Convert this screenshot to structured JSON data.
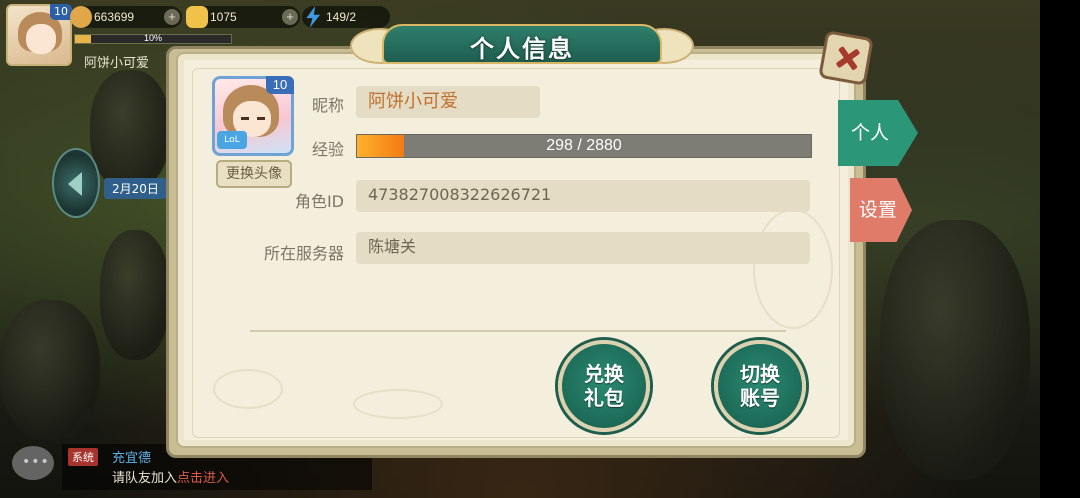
{
  "hud": {
    "level": "10",
    "exp_percent_text": "10%",
    "exp_fraction": 0.1,
    "player_name": "阿饼小可爱",
    "resources": [
      {
        "name": "coins",
        "value": "663699",
        "icon": "coin-icon",
        "color": "#e0a64a"
      },
      {
        "name": "gold-ingot",
        "value": "1075",
        "icon": "gold-ingot-icon",
        "color": "#f1c24a"
      },
      {
        "name": "stamina",
        "value": "149/2",
        "icon": "lightning-icon",
        "color": "#3e9be0"
      }
    ]
  },
  "side": {
    "date_tag": "2月20日"
  },
  "chat": {
    "system_tag": "系统",
    "line1": "充宜德",
    "line2_prefix": "请队友加入",
    "line2_link": "点击进入"
  },
  "dialog": {
    "title": "个人信息",
    "avatar_level": "10",
    "avatar_badge": "LoL",
    "change_avatar_label": "更换头像",
    "fields": {
      "nickname_label": "昵称",
      "nickname_value": "阿饼小可爱",
      "exp_label": "经验",
      "exp_text": "298 / 2880",
      "exp_current": 298,
      "exp_max": 2880,
      "role_id_label": "角色ID",
      "role_id_value": "473827008322626721",
      "server_label": "所在服务器",
      "server_value": "陈塘关"
    },
    "buttons": {
      "redeem_line1": "兑换",
      "redeem_line2": "礼包",
      "switch_line1": "切换",
      "switch_line2": "账号"
    },
    "tabs": {
      "personal": "个人",
      "settings": "设置"
    }
  },
  "colors": {
    "accent_green": "#2c9678",
    "tab_red": "#e07b6a",
    "exp_orange": "#f37a14",
    "nickname_orange": "#c0702e"
  }
}
